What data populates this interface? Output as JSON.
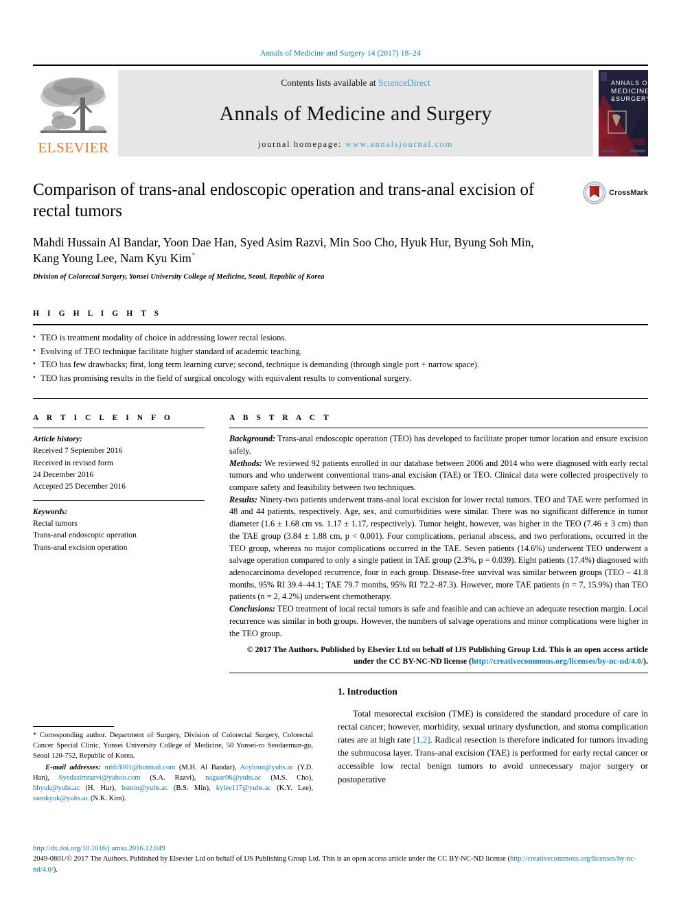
{
  "running_head": "Annals of Medicine and Surgery 14 (2017) 18–24",
  "masthead": {
    "publisher_name": "ELSEVIER",
    "contents_prefix": "Contents lists available at ",
    "contents_link": "ScienceDirect",
    "journal_title": "Annals of Medicine and Surgery",
    "homepage_label": "journal homepage:",
    "homepage_url": "www.annalsjournal.com",
    "cover_title_line1": "ANNALS OF",
    "cover_title_line2": "MEDICINE",
    "cover_title_line3": "& SURGERY"
  },
  "article": {
    "title": "Comparison of trans-anal endoscopic operation and trans-anal excision of rectal tumors",
    "authors": "Mahdi Hussain Al Bandar, Yoon Dae Han, Syed Asim Razvi, Min Soo Cho, Hyuk Hur, Byung Soh Min, Kang Young Lee, Nam Kyu Kim",
    "corresponding_marker": "*",
    "affiliation": "Division of Colorectal Surgery, Yonsei University College of Medicine, Seoul, Republic of Korea",
    "crossmark_label": "CrossMark"
  },
  "highlights": {
    "heading": "H I G H L I G H T S",
    "items": [
      "TEO is treatment modality of choice in addressing lower rectal lesions.",
      "Evolving of TEO technique facilitate higher standard of academic teaching.",
      "TEO has few drawbacks; first, long term learning curve; second, technique is demanding (through single port + narrow space).",
      "TEO has promising results in the field of surgical oncology with equivalent results to conventional surgery."
    ]
  },
  "article_info": {
    "heading": "A R T I C L E   I N F O",
    "history_label": "Article history:",
    "history_lines": [
      "Received 7 September 2016",
      "Received in revised form",
      "24 December 2016",
      "Accepted 25 December 2016"
    ],
    "keywords_label": "Keywords:",
    "keywords": [
      "Rectal tumors",
      "Trans-anal endoscopic operation",
      "Trans-anal excision operation"
    ]
  },
  "abstract": {
    "heading": "A B S T R A C T",
    "sections": [
      {
        "label": "Background:",
        "text": " Trans-anal endoscopic operation (TEO) has developed to facilitate proper tumor location and ensure excision safely."
      },
      {
        "label": "Methods:",
        "text": " We reviewed 92 patients enrolled in our database between 2006 and 2014 who were diagnosed with early rectal tumors and who underwent conventional trans-anal excision (TAE) or TEO. Clinical data were collected prospectively to compare safety and feasibility between two techniques."
      },
      {
        "label": "Results:",
        "text": " Ninety-two patients underwent trans-anal local excision for lower rectal tumors. TEO and TAE were performed in 48 and 44 patients, respectively. Age, sex, and comorbidities were similar. There was no significant difference in tumor diameter (1.6 ± 1.68 cm vs. 1.17 ± 1.17, respectively). Tumor height, however, was higher in the TEO (7.46 ± 3 cm) than the TAE group (3.84 ± 1.88 cm, p < 0.001). Four complications, perianal abscess, and two perforations, occurred in the TEO group, whereas no major complications occurred in the TAE. Seven patients (14.6%) underwent TEO underwent a salvage operation compared to only a single patient in TAE group (2.3%, p = 0.039). Eight patients (17.4%) diagnosed with adenocarcinoma developed recurrence, four in each group. Disease-free survival was similar between groups (TEO – 41.8 months, 95% RI 39.4–44.1; TAE 79.7 months, 95% RI 72.2–87.3). However, more TAE patients (n = 7, 15.9%) than TEO patients (n = 2, 4.2%) underwent chemotherapy."
      },
      {
        "label": "Conclusions:",
        "text": " TEO treatment of local rectal tumors is safe and feasible and can achieve an adequate resection margin. Local recurrence was similar in both groups. However, the numbers of salvage operations and minor complications were higher in the TEO group."
      }
    ],
    "copyright_text": "© 2017 The Authors. Published by Elsevier Ltd on behalf of IJS Publishing Group Ltd. This is an open access article under the CC BY-NC-ND license (",
    "copyright_link": "http://creativecommons.org/licenses/by-nc-nd/4.0/",
    "copyright_suffix": ")."
  },
  "footnote": {
    "marker": "*",
    "corresponding_text": " Corresponding author. Department of Surgery, Division of Colorectal Surgery, Colorectal Cancer Special Clinic, Yonsei University College of Medicine, 50 Yonsei-ro Seodaemun-gu, Seoul 120-752, Republic of Korea.",
    "email_label": "E-mail addresses:",
    "emails": [
      {
        "address": "mhb3001@hotmail.com",
        "owner": " (M.H. Al Bandar), "
      },
      {
        "address": "Acyloon@yuhs.ac",
        "owner": " (Y.D. Han), "
      },
      {
        "address": "Syedasimrazvi@yahoo.com",
        "owner": " (S.A. Razvi), "
      },
      {
        "address": "nagase96@yuhs.ac",
        "owner": " (M.S. Cho), "
      },
      {
        "address": "hhyuk@yuhs.ac",
        "owner": " (H. Hur), "
      },
      {
        "address": "bsmin@yuhs.ac",
        "owner": " (B.S. Min), "
      },
      {
        "address": "kylee117@yuhs.ac",
        "owner": " (K.Y. Lee), "
      },
      {
        "address": "namkyuk@yuhs.ac",
        "owner": " (N.K. Kim)."
      }
    ]
  },
  "introduction": {
    "heading": "1. Introduction",
    "paragraph_part1": "Total mesorectal excision (TME) is considered the standard procedure of care in rectal cancer; however, morbidity, sexual urinary dysfunction, and stoma complication rates are at high rate ",
    "citation": "[1,2]",
    "paragraph_part2": ". Radical resection is therefore indicated for tumors invading the submucosa layer. Trans-anal excision (TAE) is performed for early rectal cancer or accessible low rectal benign tumors to avoid unnecessary major surgery or postoperative"
  },
  "footer": {
    "doi": "http://dx.doi.org/10.1016/j.amsu.2016.12.049",
    "issn_line_part1": "2049-0801/© 2017 The Authors. Published by Elsevier Ltd on behalf of IJS Publishing Group Ltd. This is an open access article under the CC BY-NC-ND license (",
    "issn_link": "http://creativecommons.org/licenses/by-nc-nd/4.0/",
    "issn_line_part2": ")."
  },
  "colors": {
    "link_blue": "#0b7ab5",
    "sciencedirect_blue": "#3b9fd4",
    "elsevier_orange": "#E87722",
    "masthead_grey": "#e6e6e6"
  }
}
